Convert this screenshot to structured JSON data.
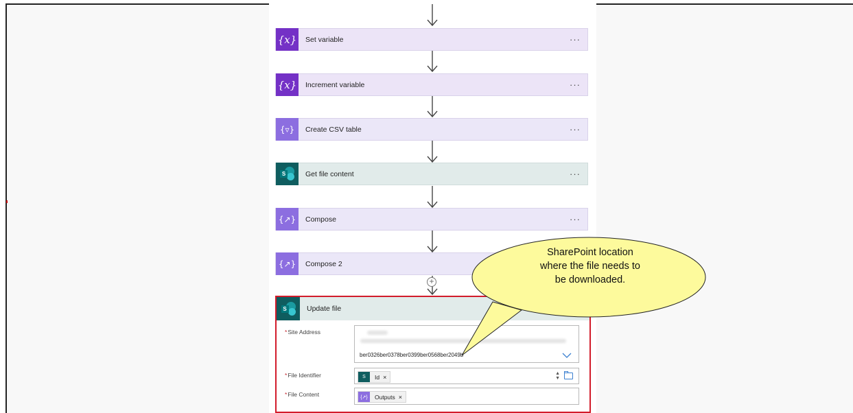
{
  "flow": {
    "steps": [
      {
        "label": "Set variable",
        "icon": "variable-icon",
        "more": "···"
      },
      {
        "label": "Increment variable",
        "icon": "variable-icon",
        "more": "···"
      },
      {
        "label": "Create CSV table",
        "icon": "data-operation-icon",
        "more": "···"
      },
      {
        "label": "Get file content",
        "icon": "sharepoint-icon",
        "more": "···"
      },
      {
        "label": "Compose",
        "icon": "data-operation-icon",
        "more": "···"
      },
      {
        "label": "Compose 2",
        "icon": "data-operation-icon"
      }
    ],
    "variable_glyph": "{x}",
    "csv_glyph": "{▿}",
    "compose_glyph": "{↗}",
    "sp_letter": "S"
  },
  "update_file": {
    "title": "Update file",
    "highlight_color": "#d21b2a",
    "fields": {
      "site_address": {
        "label": "Site Address",
        "required": "*",
        "value": "ber0326ber0378ber0399ber0568ber2049b"
      },
      "file_identifier": {
        "label": "File Identifier",
        "required": "*",
        "token": "Id",
        "token_remove": "×"
      },
      "file_content": {
        "label": "File Content",
        "required": "*",
        "token": "Outputs",
        "token_remove": "×"
      }
    }
  },
  "callout": {
    "lines": [
      "SharePoint location",
      "where the file needs to",
      "be downloaded."
    ],
    "fill": "#fdfa9c"
  },
  "colors": {
    "variable_icon": "#7431c6",
    "data_icon": "#8c6ee0",
    "sharepoint_icon": "#0f5d5f"
  }
}
